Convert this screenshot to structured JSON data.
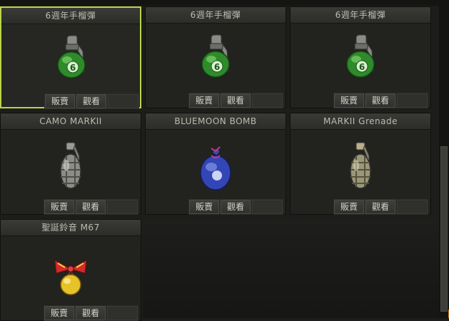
{
  "inventory": {
    "action_sell": "販賣",
    "action_view": "觀看",
    "items": [
      {
        "name": "6週年手榴彈",
        "icon": "green-6-grenade-icon",
        "selected": true
      },
      {
        "name": "6週年手榴彈",
        "icon": "green-6-grenade-icon",
        "selected": false
      },
      {
        "name": "6週年手榴彈",
        "icon": "green-6-grenade-icon",
        "selected": false
      },
      {
        "name": "CAMO MARKII",
        "icon": "camo-grenade-icon",
        "selected": false
      },
      {
        "name": "BLUEMOON BOMB",
        "icon": "blue-bag-bomb-icon",
        "selected": false
      },
      {
        "name": "MARKII Grenade",
        "icon": "frag-grenade-icon",
        "selected": false
      },
      {
        "name": "聖誕鈴音 M67",
        "icon": "christmas-bell-icon",
        "selected": false
      }
    ]
  },
  "colors": {
    "selected_border": "#b9d74a",
    "scroll_accent": "#e07a10"
  }
}
